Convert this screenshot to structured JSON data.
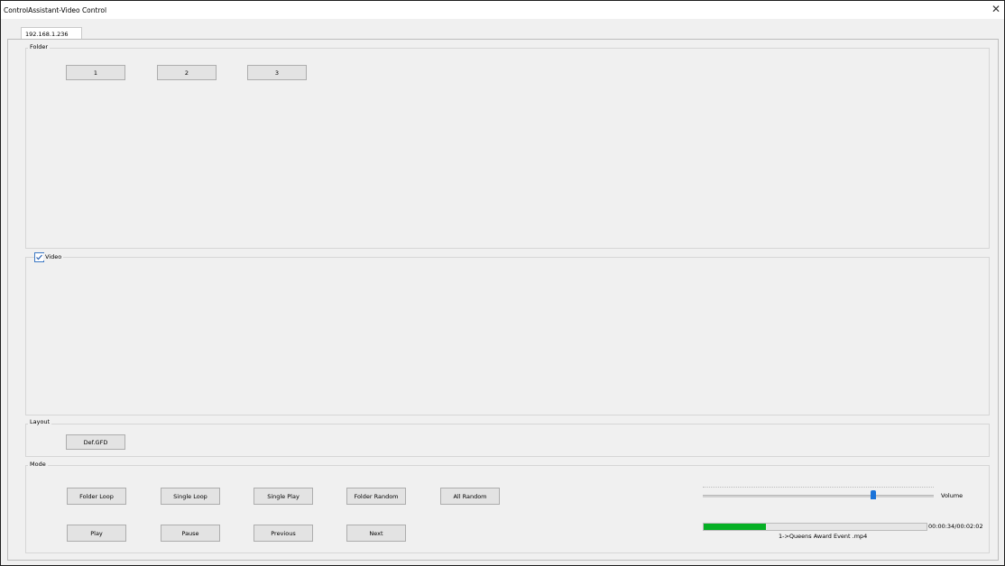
{
  "window": {
    "title": "ControlAssistant-Video Control",
    "close_glyph": "✕"
  },
  "tab": {
    "label": "192.168.1.236"
  },
  "folder": {
    "label": "Folder",
    "buttons": [
      "1",
      "2",
      "3"
    ]
  },
  "video": {
    "label": "Video",
    "checked": true
  },
  "layout": {
    "label": "Layout",
    "button": "Def.GFD"
  },
  "mode": {
    "label": "Mode",
    "row1": [
      "Folder Loop",
      "Single Loop",
      "Single Play",
      "Folder Random",
      "All Random"
    ],
    "row2": [
      "Play",
      "Pause",
      "Previous",
      "Next"
    ],
    "volume_label": "Volume",
    "volume_level": 0.74,
    "time": "00:00:34/00:02:02",
    "progress": 0.278,
    "now_playing": "1->Queens Award Event .mp4"
  },
  "colors": {
    "progress": "#06b025",
    "slider_thumb": "#1a73d9"
  }
}
